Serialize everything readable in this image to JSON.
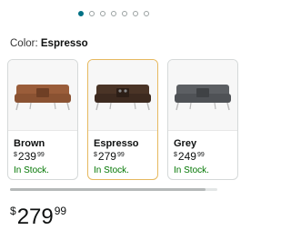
{
  "carousel": {
    "dot_count": 7,
    "active_index": 0
  },
  "color": {
    "label": "Color:",
    "value": "Espresso"
  },
  "options": [
    {
      "name": "Brown",
      "currency": "$",
      "price_whole": "239",
      "price_fraction": "99",
      "stock": "In Stock.",
      "sofa_color": "#9a5d3a",
      "icon": "sofa-brown-image",
      "selected": false
    },
    {
      "name": "Espresso",
      "currency": "$",
      "price_whole": "279",
      "price_fraction": "99",
      "stock": "In Stock.",
      "sofa_color": "#4a3426",
      "icon": "sofa-espresso-image",
      "selected": true
    },
    {
      "name": "Grey",
      "currency": "$",
      "price_whole": "249",
      "price_fraction": "99",
      "stock": "In Stock.",
      "sofa_color": "#5c5f63",
      "icon": "sofa-grey-image",
      "selected": false
    }
  ],
  "price": {
    "currency": "$",
    "whole": "279",
    "fraction": "99"
  },
  "colors": {
    "accent": "#007185",
    "selected_border": "#e6b95f",
    "in_stock": "#007600"
  }
}
